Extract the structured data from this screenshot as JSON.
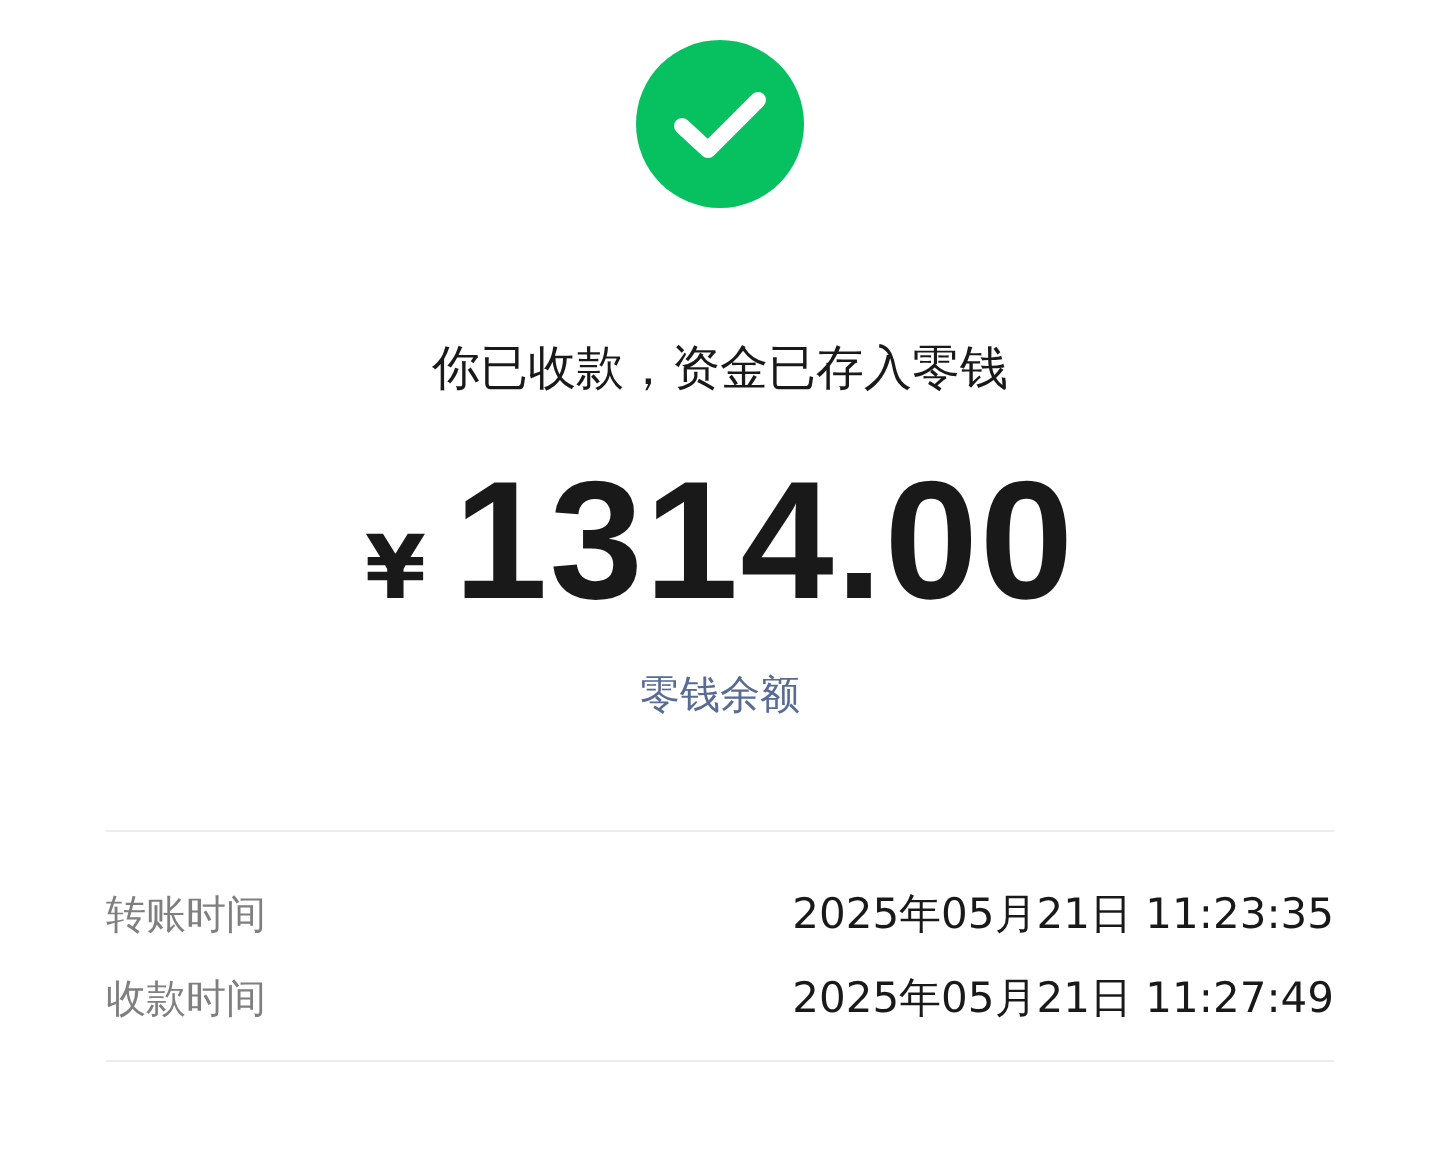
{
  "status": {
    "kind": "success",
    "message": "你已收款，资金已存入零钱"
  },
  "amount": {
    "currency": "¥",
    "value": "1314.00"
  },
  "balance_link": "零钱余额",
  "details": [
    {
      "label": "转账时间",
      "value": "2025年05月21日 11:23:35"
    },
    {
      "label": "收款时间",
      "value": "2025年05月21日 11:27:49"
    }
  ]
}
